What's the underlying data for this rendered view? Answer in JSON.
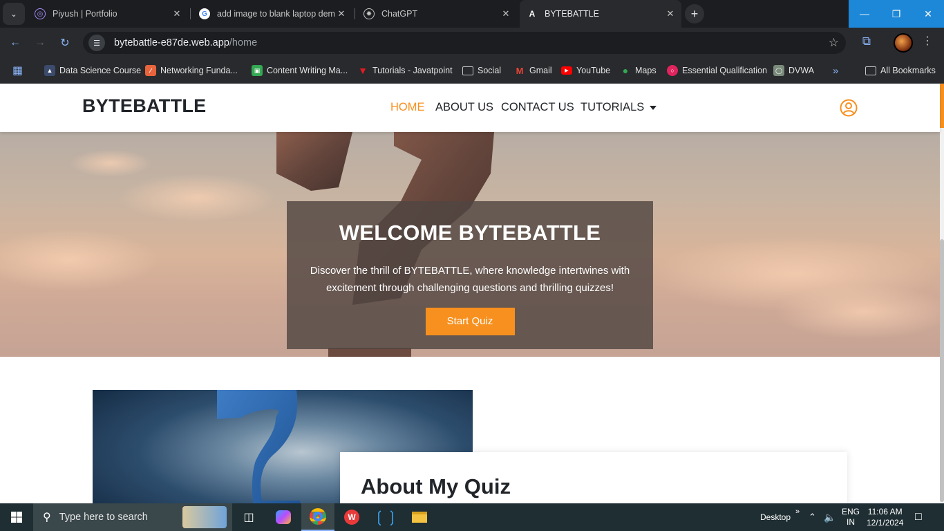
{
  "browser": {
    "tabs": [
      {
        "title": "Piyush | Portfolio",
        "icon": "portfolio-favicon"
      },
      {
        "title": "add image to blank laptop dem",
        "icon": "google-favicon"
      },
      {
        "title": "ChatGPT",
        "icon": "chatgpt-favicon"
      },
      {
        "title": "BYTEBATTLE",
        "icon": "bytebattle-favicon",
        "active": true
      }
    ],
    "url_host": "bytebattle-e87de.web.app",
    "url_path": "/home",
    "bookmarks": [
      {
        "label": "Data Science Course",
        "color": "#4285f4"
      },
      {
        "label": "Networking Funda...",
        "color": "#e8643c"
      },
      {
        "label": "Content Writing Ma...",
        "color": "#34a853"
      },
      {
        "label": "Tutorials - Javatpoint",
        "color": "#e21b23"
      },
      {
        "label": "Social",
        "color": "#9aa0a6"
      },
      {
        "label": "Gmail",
        "color": "#ea4335"
      },
      {
        "label": "YouTube",
        "color": "#ff0000"
      },
      {
        "label": "Maps",
        "color": "#34a853"
      },
      {
        "label": "Essential Qualification",
        "color": "#e0245e"
      },
      {
        "label": "DVWA",
        "color": "#7a8a7a"
      }
    ],
    "all_bookmarks": "All Bookmarks"
  },
  "site": {
    "brand": "BYTEBATTLE",
    "nav": {
      "home": "HOME",
      "about": "ABOUT US",
      "contact": "CONTACT US",
      "tutorials": "TUTORIALS"
    },
    "hero": {
      "title": "WELCOME BYTEBATTLE",
      "text": "Discover the thrill of BYTEBATTLE, where knowledge intertwines with excitement through challenging questions and thrilling quizzes!",
      "button": "Start Quiz"
    },
    "about_title": "About My Quiz",
    "accent": "#f7901e"
  },
  "taskbar": {
    "search_placeholder": "Type here to search",
    "desktop_label": "Desktop",
    "lang_top": "ENG",
    "lang_bottom": "IN",
    "time": "11:06 AM",
    "date": "12/1/2024"
  }
}
